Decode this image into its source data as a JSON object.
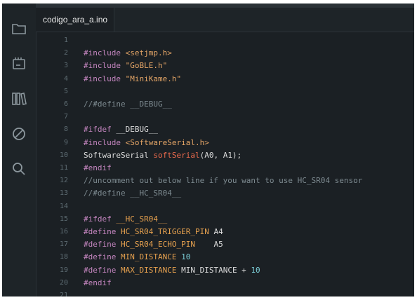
{
  "tab": {
    "filename": "codigo_ara_a.ino"
  },
  "activity_bar": {
    "icons": [
      "folder-icon",
      "board-icon",
      "library-icon",
      "debug-icon",
      "search-icon"
    ]
  },
  "colors": {
    "background": "#1b2024",
    "keyword": "#c586c0",
    "string": "#e3a466",
    "comment": "#7d8a90",
    "number": "#7ccfd9",
    "macro": "#e8a24f",
    "function": "#f06c4e"
  },
  "lines": [
    {
      "n": "1",
      "segs": []
    },
    {
      "n": "2",
      "segs": [
        {
          "t": "#include ",
          "c": "kw"
        },
        {
          "t": "<setjmp.h>",
          "c": "str"
        }
      ]
    },
    {
      "n": "3",
      "segs": [
        {
          "t": "#include ",
          "c": "kw"
        },
        {
          "t": "\"GoBLE.h\"",
          "c": "str"
        }
      ]
    },
    {
      "n": "4",
      "segs": [
        {
          "t": "#include ",
          "c": "kw"
        },
        {
          "t": "\"MiniKame.h\"",
          "c": "str"
        }
      ]
    },
    {
      "n": "5",
      "segs": []
    },
    {
      "n": "6",
      "segs": [
        {
          "t": "//#define __DEBUG__",
          "c": "cm"
        }
      ]
    },
    {
      "n": "7",
      "segs": []
    },
    {
      "n": "8",
      "segs": [
        {
          "t": "#ifdef ",
          "c": "kw"
        },
        {
          "t": "__DEBUG__",
          "c": "txt"
        }
      ]
    },
    {
      "n": "9",
      "segs": [
        {
          "t": "#include ",
          "c": "kw"
        },
        {
          "t": "<SoftwareSerial.h>",
          "c": "str"
        }
      ]
    },
    {
      "n": "10",
      "segs": [
        {
          "t": "SoftwareSerial ",
          "c": "txt"
        },
        {
          "t": "softSerial",
          "c": "fn"
        },
        {
          "t": "(A0, A1);",
          "c": "txt"
        }
      ]
    },
    {
      "n": "11",
      "segs": [
        {
          "t": "#endif",
          "c": "kw"
        }
      ]
    },
    {
      "n": "12",
      "segs": [
        {
          "t": "//uncomment out below line if you want to use HC_SR04 sensor",
          "c": "cm"
        }
      ]
    },
    {
      "n": "13",
      "segs": [
        {
          "t": "//#define __HC_SR04__",
          "c": "cm"
        }
      ]
    },
    {
      "n": "14",
      "segs": []
    },
    {
      "n": "15",
      "segs": [
        {
          "t": "#ifdef ",
          "c": "kw"
        },
        {
          "t": "__HC_SR04__",
          "c": "def"
        }
      ]
    },
    {
      "n": "16",
      "segs": [
        {
          "t": "#define ",
          "c": "kw"
        },
        {
          "t": "HC_SR04_TRIGGER_PIN",
          "c": "def"
        },
        {
          "t": " A4",
          "c": "txt"
        }
      ]
    },
    {
      "n": "17",
      "segs": [
        {
          "t": "#define ",
          "c": "kw"
        },
        {
          "t": "HC_SR04_ECHO_PIN",
          "c": "def"
        },
        {
          "t": "    A5",
          "c": "txt"
        }
      ]
    },
    {
      "n": "18",
      "segs": [
        {
          "t": "#define ",
          "c": "kw"
        },
        {
          "t": "MIN_DISTANCE",
          "c": "def"
        },
        {
          "t": " ",
          "c": "txt"
        },
        {
          "t": "10",
          "c": "num"
        }
      ]
    },
    {
      "n": "19",
      "segs": [
        {
          "t": "#define ",
          "c": "kw"
        },
        {
          "t": "MAX_DISTANCE",
          "c": "def"
        },
        {
          "t": " MIN_DISTANCE + ",
          "c": "txt"
        },
        {
          "t": "10",
          "c": "num"
        }
      ]
    },
    {
      "n": "20",
      "segs": [
        {
          "t": "#endif",
          "c": "kw"
        }
      ]
    },
    {
      "n": "21",
      "segs": []
    }
  ]
}
